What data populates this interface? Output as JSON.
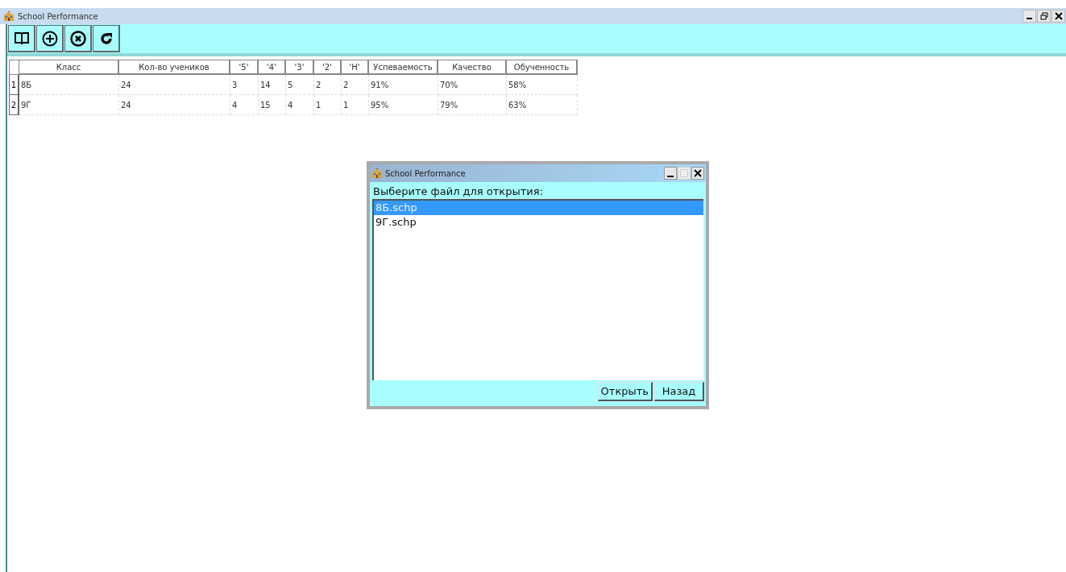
{
  "window": {
    "title": "School Performance"
  },
  "toolbar": {
    "buttons": [
      {
        "kind": "book"
      },
      {
        "kind": "add"
      },
      {
        "kind": "remove"
      },
      {
        "kind": "refresh"
      }
    ]
  },
  "table": {
    "columns": [
      "Класс",
      "Кол-во учеников",
      "'5'",
      "'4'",
      "'3'",
      "'2'",
      "'Н'",
      "Успеваемость",
      "Качество",
      "Обученность"
    ],
    "rows": [
      {
        "number": "1",
        "cells": [
          "8Б",
          "24",
          "3",
          "14",
          "5",
          "2",
          "2",
          "91%",
          "70%",
          "58%"
        ]
      },
      {
        "number": "2",
        "cells": [
          "9Г",
          "24",
          "4",
          "15",
          "4",
          "1",
          "1",
          "95%",
          "79%",
          "63%"
        ]
      }
    ]
  },
  "dialog": {
    "title": "School Performance",
    "prompt": "Выберите файл для открытия:",
    "maximize_disabled": true,
    "files": [
      {
        "name": "8Б.schp",
        "selected": true
      },
      {
        "name": "9Г.schp",
        "selected": false
      }
    ],
    "buttons": [
      "Открыть",
      "Назад"
    ]
  }
}
